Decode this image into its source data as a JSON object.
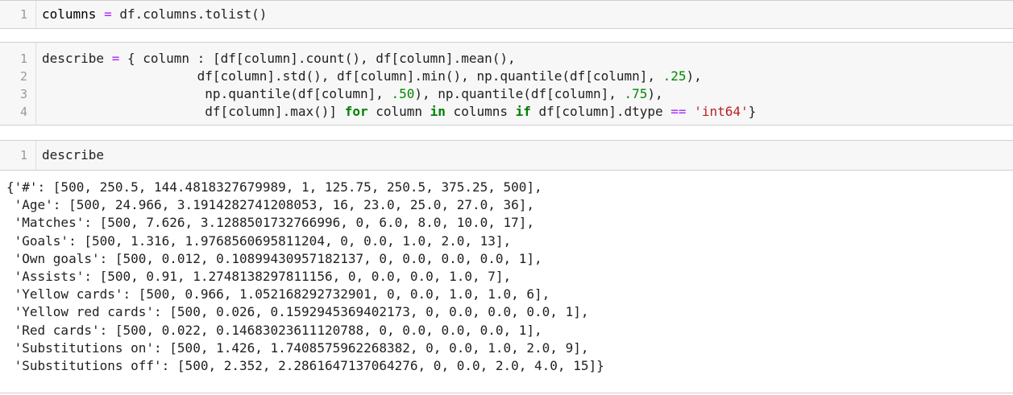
{
  "cell1": {
    "line_numbers": [
      "1"
    ],
    "code": {
      "lhs": "columns",
      "op": "=",
      "rhs": "df.columns.tolist()"
    }
  },
  "cell2": {
    "line_numbers": [
      "1",
      "2",
      "3",
      "4"
    ],
    "code": {
      "l1_a": "describe",
      "l1_op": "=",
      "l1_b": "{ column : [df[column].count(), df[column].mean(),",
      "l2_a": "df[column].std(), df[column].min(), np.quantile(df[column], ",
      "l2_n": ".25",
      "l2_b": "),",
      "l3_a": "np.quantile(df[column], ",
      "l3_n1": ".50",
      "l3_b": "), np.quantile(df[column], ",
      "l3_n2": ".75",
      "l3_c": "),",
      "l4_a": "df[column].max()] ",
      "l4_for": "for",
      "l4_b": " column ",
      "l4_in": "in",
      "l4_c": " columns ",
      "l4_if": "if",
      "l4_d": " df[column].dtype ",
      "l4_eq": "==",
      "l4_str": "'int64'",
      "l4_e": "}"
    }
  },
  "cell3": {
    "line_numbers": [
      "1"
    ],
    "code": "describe"
  },
  "output": {
    "lines": [
      "{'#': [500, 250.5, 144.4818327679989, 1, 125.75, 250.5, 375.25, 500],",
      " 'Age': [500, 24.966, 3.1914282741208053, 16, 23.0, 25.0, 27.0, 36],",
      " 'Matches': [500, 7.626, 3.1288501732766996, 0, 6.0, 8.0, 10.0, 17],",
      " 'Goals': [500, 1.316, 1.9768560695811204, 0, 0.0, 1.0, 2.0, 13],",
      " 'Own goals': [500, 0.012, 0.10899430957182137, 0, 0.0, 0.0, 0.0, 1],",
      " 'Assists': [500, 0.91, 1.2748138297811156, 0, 0.0, 0.0, 1.0, 7],",
      " 'Yellow cards': [500, 0.966, 1.052168292732901, 0, 0.0, 1.0, 1.0, 6],",
      " 'Yellow red cards': [500, 0.026, 0.1592945369402173, 0, 0.0, 0.0, 0.0, 1],",
      " 'Red cards': [500, 0.022, 0.14683023611120788, 0, 0.0, 0.0, 0.0, 1],",
      " 'Substitutions on': [500, 1.426, 1.7408575962268382, 0, 0.0, 1.0, 2.0, 9],",
      " 'Substitutions off': [500, 2.352, 2.2861647137064276, 0, 0.0, 2.0, 4.0, 15]}"
    ]
  }
}
